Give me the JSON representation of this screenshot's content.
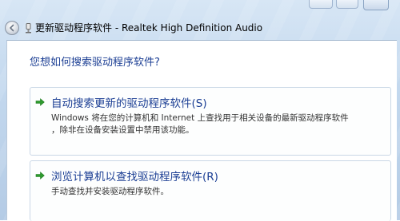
{
  "window": {
    "title": "更新驱动程序软件 - Realtek High Definition Audio"
  },
  "icons": {
    "back": "back-arrow-icon",
    "app": "device-driver-icon",
    "option_arrow": "green-arrow-icon"
  },
  "main": {
    "question": "您想如何搜索驱动程序软件?",
    "options": [
      {
        "title": "自动搜索更新的驱动程序软件(S)",
        "description_line1": "Windows 将在您的计算机和 Internet 上查找用于相关设备的最新驱动程序软件",
        "description_line2": "，除非在设备安装设置中禁用该功能。"
      },
      {
        "title": "浏览计算机以查找驱动程序软件(R)",
        "description_line1": "手动查找并安装驱动程序软件。"
      }
    ]
  },
  "colors": {
    "accent_text": "#1c3f94",
    "arrow_green": "#2e9b2e"
  }
}
